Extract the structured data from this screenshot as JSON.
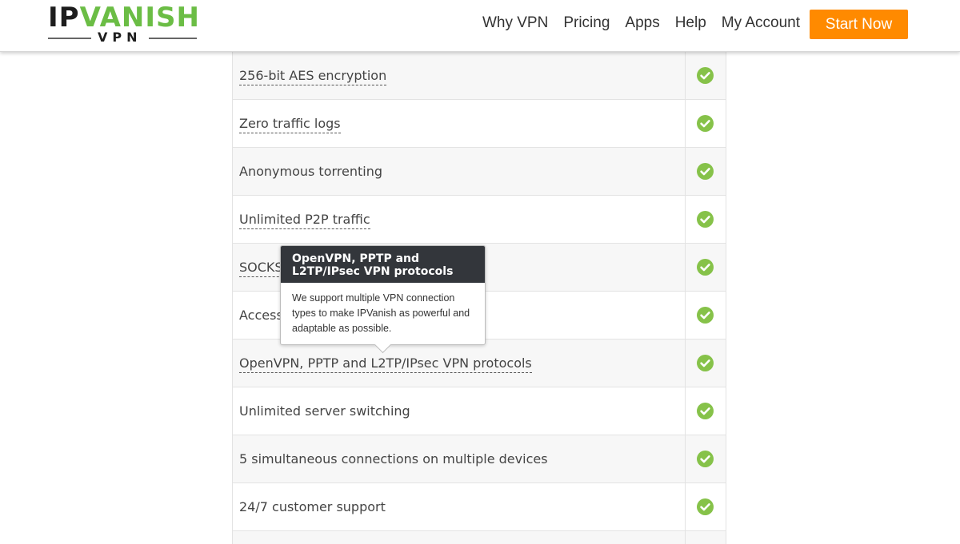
{
  "header": {
    "logo": {
      "main_ip": "IP",
      "main_vanish": "VANISH",
      "sub": "VPN"
    },
    "nav": [
      {
        "label": "Why VPN"
      },
      {
        "label": "Pricing"
      },
      {
        "label": "Apps"
      },
      {
        "label": "Help"
      },
      {
        "label": "My Account"
      }
    ],
    "cta_label": "Start Now"
  },
  "features": [
    {
      "label": "256-bit AES encryption",
      "has_tooltip": true,
      "included": true
    },
    {
      "label": "Zero traffic logs",
      "has_tooltip": true,
      "included": true
    },
    {
      "label": "Anonymous torrenting",
      "has_tooltip": false,
      "included": true
    },
    {
      "label": "Unlimited P2P traffic",
      "has_tooltip": true,
      "included": true
    },
    {
      "label": "SOCKS",
      "has_tooltip": true,
      "included": true
    },
    {
      "label": "Access",
      "has_tooltip": false,
      "included": true
    },
    {
      "label": "OpenVPN, PPTP and L2TP/IPsec VPN protocols",
      "has_tooltip": true,
      "included": true
    },
    {
      "label": "Unlimited server switching",
      "has_tooltip": false,
      "included": true
    },
    {
      "label": "5 simultaneous connections on multiple devices",
      "has_tooltip": false,
      "included": true
    },
    {
      "label": "24/7 customer support",
      "has_tooltip": false,
      "included": true
    }
  ],
  "tooltip": {
    "title": "OpenVPN, PPTP and L2TP/IPsec VPN protocols",
    "body": "We support multiple VPN connection types to make IPVanish as powerful and adaptable as possible."
  },
  "colors": {
    "brand_green": "#6bbd45",
    "check_green": "#86c249",
    "cta_orange": "#ff8a00",
    "tooltip_header": "#33363b"
  },
  "icons": {
    "check": "check-circle-icon"
  }
}
